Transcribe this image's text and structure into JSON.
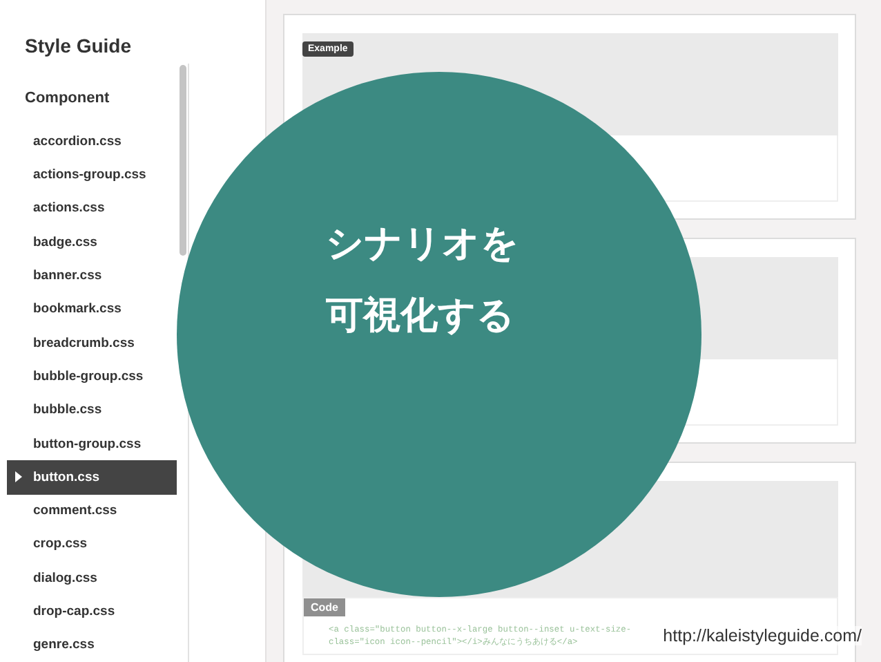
{
  "sidebar": {
    "title": "Style Guide",
    "section": "Component",
    "items": [
      {
        "label": "accordion.css",
        "selected": false
      },
      {
        "label": "actions-group.css",
        "selected": false
      },
      {
        "label": "actions.css",
        "selected": false
      },
      {
        "label": "badge.css",
        "selected": false
      },
      {
        "label": "banner.css",
        "selected": false
      },
      {
        "label": "bookmark.css",
        "selected": false
      },
      {
        "label": "breadcrumb.css",
        "selected": false
      },
      {
        "label": "bubble-group.css",
        "selected": false
      },
      {
        "label": "bubble.css",
        "selected": false
      },
      {
        "label": "button-group.css",
        "selected": false
      },
      {
        "label": "button.css",
        "selected": true
      },
      {
        "label": "comment.css",
        "selected": false
      },
      {
        "label": "crop.css",
        "selected": false
      },
      {
        "label": "dialog.css",
        "selected": false
      },
      {
        "label": "drop-cap.css",
        "selected": false
      },
      {
        "label": "genre.css",
        "selected": false
      }
    ]
  },
  "cards": [
    {
      "kind": "example",
      "badge": "Example"
    },
    {
      "kind": "plain"
    },
    {
      "kind": "code",
      "code_label": "Code",
      "code_lines": [
        "<a class=\"button button--x-large button--inset u-text-size-",
        "class=\"icon icon--pencil\"></i>みんなにうちあける</a>"
      ]
    }
  ],
  "overlay": {
    "lines": [
      "シナリオを",
      "可視化する"
    ]
  },
  "source_url": "http://kaleistyleguide.com/"
}
